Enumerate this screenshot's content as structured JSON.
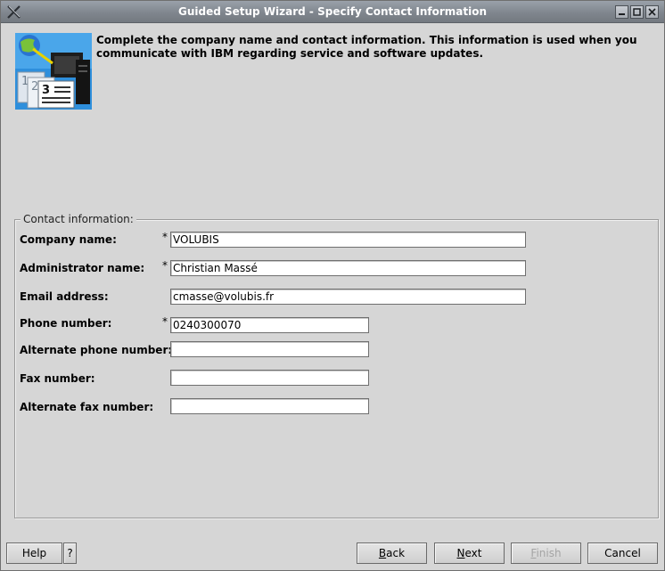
{
  "window": {
    "title": "Guided Setup Wizard - Specify Contact Information"
  },
  "header": {
    "icon": "wizard-contact-icon",
    "text": "Complete the company name and contact information.  This information is used when you\ncommunicate with IBM regarding service and software updates."
  },
  "group": {
    "legend": "Contact information:"
  },
  "fields": [
    {
      "label": "Company name:",
      "value": "VOLUBIS",
      "required": "*"
    },
    {
      "label": "Administrator name:",
      "value": "Christian Massé",
      "required": "*"
    },
    {
      "label": "Email address:",
      "value": "cmasse@volubis.fr"
    },
    {
      "label": "Phone number:",
      "value": "0240300070",
      "required": "*"
    },
    {
      "label": "Alternate phone number:",
      "value": ""
    },
    {
      "label": "Fax number:",
      "value": ""
    },
    {
      "label": "Alternate fax number:",
      "value": ""
    }
  ],
  "buttons": {
    "help": "Help",
    "help_q": "?",
    "back_mn": "B",
    "back_rest": "ack",
    "next_mn": "N",
    "next_rest": "ext",
    "finish_mn": "F",
    "finish_rest": "inish",
    "cancel": "Cancel"
  }
}
